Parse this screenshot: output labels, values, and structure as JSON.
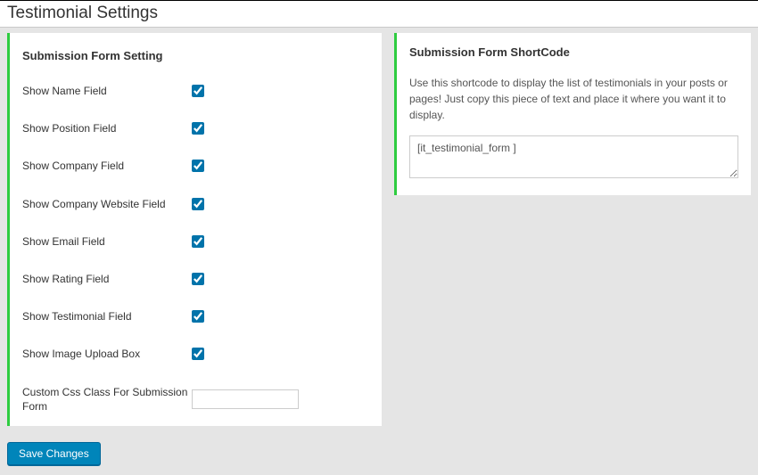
{
  "page_title": "Testimonial Settings",
  "left_panel": {
    "heading": "Submission Form Setting",
    "fields": [
      {
        "label": "Show Name Field",
        "checked": true
      },
      {
        "label": "Show Position Field",
        "checked": true
      },
      {
        "label": "Show Company Field",
        "checked": true
      },
      {
        "label": "Show Company Website Field",
        "checked": true
      },
      {
        "label": "Show Email Field",
        "checked": true
      },
      {
        "label": "Show Rating Field",
        "checked": true
      },
      {
        "label": "Show Testimonial Field",
        "checked": true
      },
      {
        "label": "Show Image Upload Box",
        "checked": true
      }
    ],
    "css_label": "Custom Css Class For Submission Form",
    "css_value": ""
  },
  "right_panel": {
    "heading": "Submission Form ShortCode",
    "description": "Use this shortcode to display the list of testimonials in your posts or pages! Just copy this piece of text and place it where you want it to display.",
    "shortcode": "[it_testimonial_form ]"
  },
  "save_label": "Save Changes"
}
